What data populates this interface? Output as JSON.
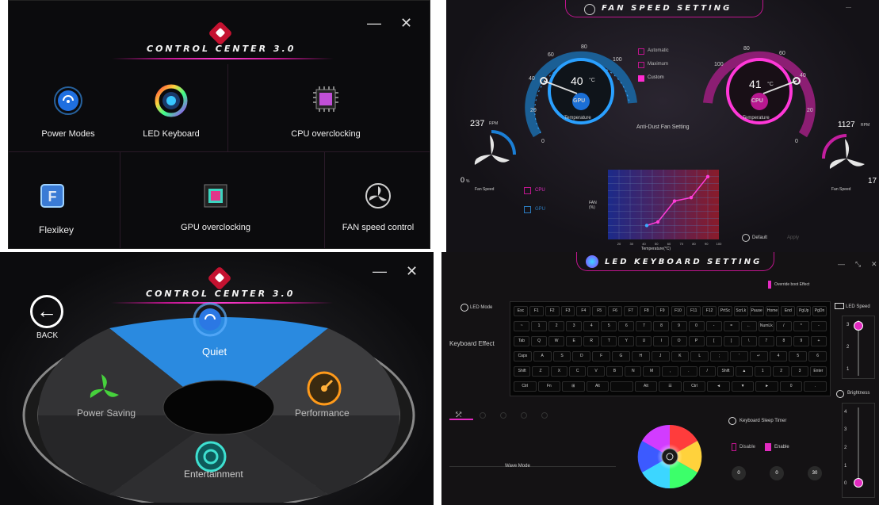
{
  "panel_main": {
    "title": "CONTROL CENTER 3.0",
    "minimize": "—",
    "close": "✕",
    "tiles": [
      {
        "label": "Power Modes",
        "icon": "power-modes-icon"
      },
      {
        "label": "LED Keyboard",
        "icon": "led-keyboard-icon"
      },
      {
        "label": "CPU overclocking",
        "icon": "cpu-chip-icon"
      },
      {
        "label": "Flexikey",
        "icon": "flexikey-icon"
      },
      {
        "label": "GPU overclocking",
        "icon": "gpu-chip-icon"
      },
      {
        "label": "FAN speed control",
        "icon": "fan-icon"
      }
    ]
  },
  "panel_fan": {
    "title": "FAN SPEED SETTING",
    "gpu": {
      "temp": "40",
      "unit": "°C",
      "chip": "GPU",
      "temp_label": "Temperature",
      "rpm": "237",
      "rpm_unit": "RPM",
      "speed_pct": "0",
      "speed_unit": "%",
      "speed_label": "Fan Speed"
    },
    "cpu": {
      "temp": "41",
      "unit": "°C",
      "chip": "CPU",
      "temp_label": "Temperature",
      "rpm": "1127",
      "rpm_unit": "RPM",
      "speed_pct": "17",
      "speed_label": "Fan Speed"
    },
    "gpu_ticks": [
      "0",
      "20",
      "40",
      "60",
      "80",
      "100"
    ],
    "cpu_ticks": [
      "100",
      "80",
      "60",
      "40",
      "20",
      "0"
    ],
    "modes": [
      "Automatic",
      "Maximum",
      "Custom"
    ],
    "anti_dust": "Anti-Dust Fan Setting",
    "curve_labels": [
      "CPU",
      "GPU"
    ],
    "fan_axis_label": "FAN (%)",
    "temp_axis_label": "Temperature(°C)",
    "default_btn": "Default",
    "apply_btn": "Apply",
    "chart_data": {
      "type": "line",
      "xlabel": "Temperature(°C)",
      "ylabel": "FAN (%)",
      "xlim": [
        0,
        100
      ],
      "ylim": [
        0,
        100
      ],
      "series": [
        {
          "name": "",
          "x": [
            35,
            45,
            60,
            75,
            90
          ],
          "y": [
            20,
            25,
            55,
            60,
            90
          ]
        }
      ],
      "x_ticks": [
        "20",
        "30",
        "40",
        "50",
        "60",
        "70",
        "80",
        "90",
        "100"
      ]
    }
  },
  "panel_power": {
    "title": "CONTROL CENTER 3.0",
    "back": "BACK",
    "minimize": "—",
    "close": "✕",
    "modes": [
      {
        "label": "Quiet",
        "icon": "quiet-icon"
      },
      {
        "label": "Power Saving",
        "icon": "power-saving-icon"
      },
      {
        "label": "Performance",
        "icon": "performance-icon"
      },
      {
        "label": "Entertainment",
        "icon": "entertainment-icon"
      }
    ]
  },
  "panel_led": {
    "title": "LED KEYBOARD SETTING",
    "override": "Override boot Effect",
    "led_mode": "LED Mode",
    "keyboard_effect": "Keyboard Effect",
    "led_speed": "LED Speed",
    "brightness": "Brightness",
    "speed_ticks": [
      "3",
      "2",
      "1"
    ],
    "brightness_ticks": [
      "4",
      "3",
      "2",
      "1",
      "0"
    ],
    "sleep_timer": "Keyboard Sleep Timer",
    "disable": "Disable",
    "enable": "Enable",
    "timer_values": [
      "0",
      "0",
      "30"
    ],
    "wave_mode": "Wave Mode",
    "keys_row1": [
      "Esc",
      "F1",
      "F2",
      "F3",
      "F4",
      "F5",
      "F6",
      "F7",
      "F8",
      "F9",
      "F10",
      "F11",
      "F12",
      "PrtSc",
      "ScrLk",
      "Pause",
      "Home",
      "End",
      "PgUp",
      "PgDn"
    ],
    "keys_row2": [
      "~",
      "1",
      "2",
      "3",
      "4",
      "5",
      "6",
      "7",
      "8",
      "9",
      "0",
      "-",
      "=",
      "←",
      "NumLk",
      "/",
      "*",
      "-"
    ],
    "keys_row3": [
      "Tab",
      "Q",
      "W",
      "E",
      "R",
      "T",
      "Y",
      "U",
      "I",
      "O",
      "P",
      "[",
      "]",
      "\\",
      "7",
      "8",
      "9",
      "+"
    ],
    "keys_row4": [
      "Caps Lock",
      "A",
      "S",
      "D",
      "F",
      "G",
      "H",
      "J",
      "K",
      "L",
      ";",
      "'",
      "↵",
      "4",
      "5",
      "6"
    ],
    "keys_row5": [
      "Shift",
      "Z",
      "X",
      "C",
      "V",
      "B",
      "N",
      "M",
      ",",
      ".",
      "/",
      "Shift",
      "▲",
      "1",
      "2",
      "3",
      "Enter"
    ],
    "keys_row6": [
      "Ctrl",
      "Fn",
      "⊞",
      "Alt",
      "",
      "Alt",
      "☰",
      "Ctrl",
      "◄",
      "▼",
      "►",
      "0",
      "."
    ]
  }
}
